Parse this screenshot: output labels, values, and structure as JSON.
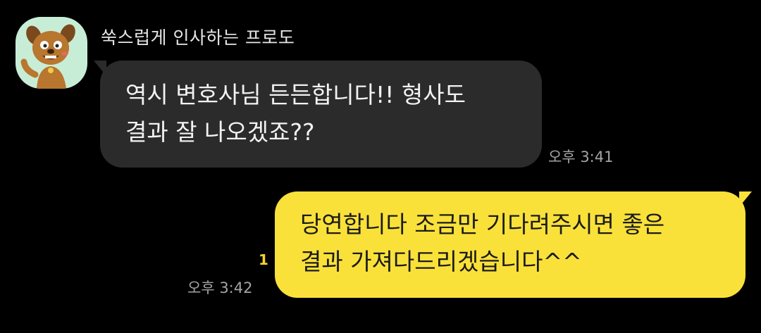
{
  "chat": {
    "sender": {
      "name": "쑥스럽게 인사하는 프로도",
      "avatar_icon": "frodo-dog-avatar-icon",
      "avatar_bg": "#c8edd6"
    },
    "messages": [
      {
        "direction": "incoming",
        "lines": [
          "역시 변호사님 든든합니다!! 형사도",
          "결과 잘 나오겠죠??"
        ],
        "time": "오후 3:41",
        "bubble_color": "#2b2b2b"
      },
      {
        "direction": "outgoing",
        "lines": [
          "당연합니다 조금만 기다려주시면 좋은",
          "결과 가져다드리겠습니다^^"
        ],
        "time": "오후 3:42",
        "unread_count": "1",
        "bubble_color": "#fae13a"
      }
    ]
  }
}
